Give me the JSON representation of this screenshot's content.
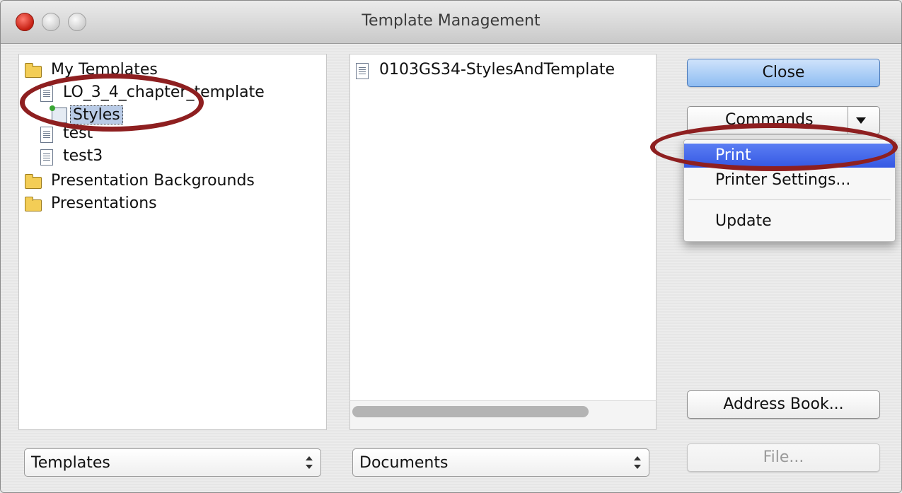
{
  "window": {
    "title": "Template Management"
  },
  "tree": {
    "items": [
      {
        "label": "My Templates",
        "icon": "folder-open-icon"
      },
      {
        "label": "LO_3_4_chapter_template",
        "icon": "document-icon"
      },
      {
        "label": "Styles",
        "icon": "styles-icon"
      },
      {
        "label": "test",
        "icon": "document-icon"
      },
      {
        "label": "test3",
        "icon": "document-icon"
      },
      {
        "label": "Presentation Backgrounds",
        "icon": "folder-icon"
      },
      {
        "label": "Presentations",
        "icon": "folder-icon"
      }
    ]
  },
  "documents": {
    "items": [
      {
        "label": "0103GS34-StylesAndTemplate",
        "icon": "document-icon"
      }
    ]
  },
  "buttons": {
    "close": "Close",
    "commands": "Commands",
    "address_book": "Address Book...",
    "file": "File..."
  },
  "commands_menu": {
    "items": [
      {
        "label": "Print",
        "highlighted": true
      },
      {
        "label": "Printer Settings..."
      },
      {
        "label": "Update"
      }
    ]
  },
  "selectors": {
    "left": "Templates",
    "right": "Documents"
  },
  "colors": {
    "annotation_ellipse": "#8e1f20",
    "menu_highlight": "#3558e3",
    "default_button": "#8ebcf2"
  }
}
